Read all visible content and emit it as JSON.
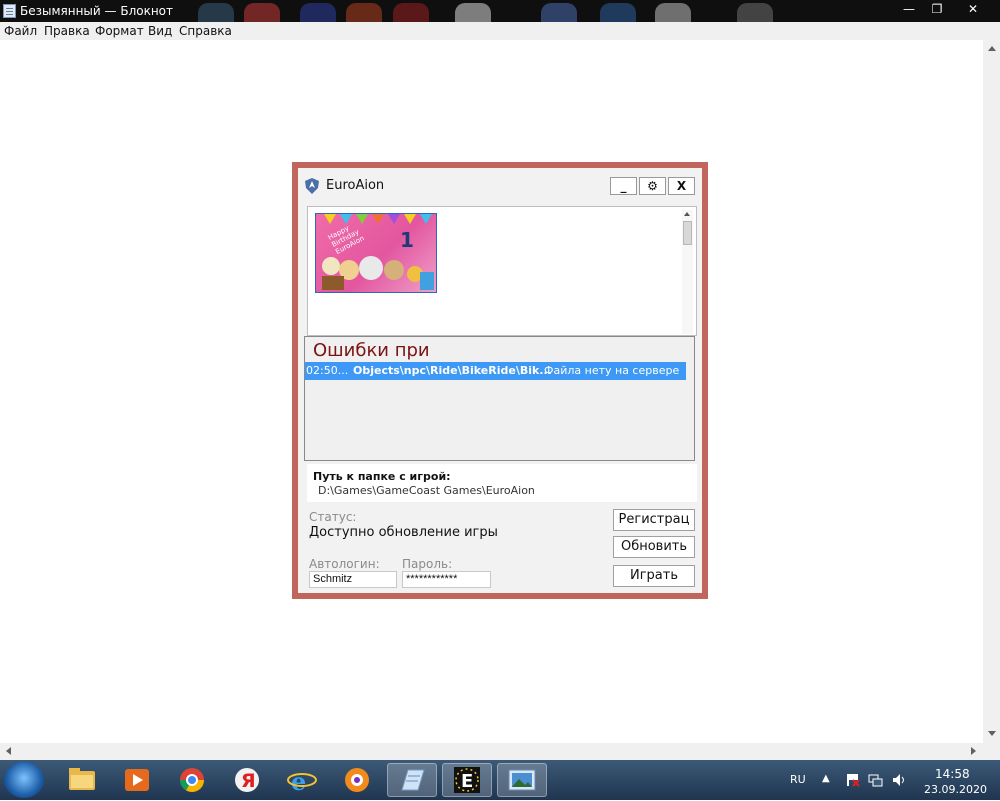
{
  "notepad": {
    "title": "Безымянный — Блокнот",
    "window_buttons": {
      "minimize": "—",
      "maximize": "❐",
      "close": "✕"
    },
    "menu": [
      "Файл",
      "Правка",
      "Формат",
      "Вид",
      "Справка"
    ]
  },
  "launcher": {
    "title": "EuroAion",
    "controls": {
      "minimize": "_",
      "settings": "⚙",
      "close": "X"
    },
    "news_banner_text": "Happy Birthday EuroAion",
    "news_banner_number": "1",
    "errors": {
      "title": "Ошибки при",
      "rows": [
        {
          "time": "02:50...",
          "file": "Objects\\npc\\Ride\\BikeRide\\Bik...",
          "message": "Файла нету на сервере"
        }
      ]
    },
    "path": {
      "label": "Путь к папке с игрой:",
      "value": "D:\\Games\\GameCoast Games\\EuroAion"
    },
    "status": {
      "label": "Статус:",
      "value": "Доступно обновление игры"
    },
    "autologin": {
      "label": "Автологин:",
      "value": "Schmitz"
    },
    "password": {
      "label": "Пароль:",
      "value": "************"
    },
    "buttons": {
      "register": "Регистрац",
      "update": "Обновить",
      "play": "Играть"
    },
    "colors": {
      "frame": "#c0665d",
      "selection": "#3d99f5",
      "error_title": "#7a1414"
    }
  },
  "taskbar": {
    "apps": [
      "windows-explorer",
      "media-player",
      "chrome",
      "yandex-browser",
      "internet-explorer",
      "avast",
      "notepad",
      "euroaion-launcher",
      "image-viewer"
    ],
    "language": "RU",
    "time": "14:58",
    "date": "23.09.2020"
  }
}
